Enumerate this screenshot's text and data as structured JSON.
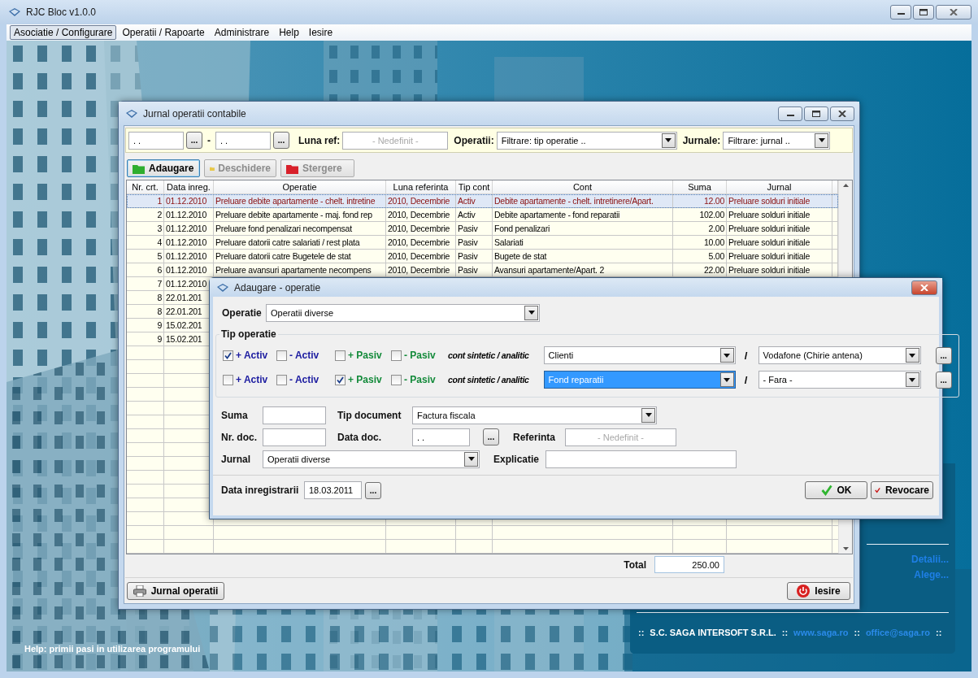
{
  "window": {
    "title": "RJC Bloc v1.0.0"
  },
  "menu": [
    {
      "label": "Asociatie / Configurare",
      "selected": true
    },
    {
      "label": "Operatii / Rapoarte",
      "selected": false
    },
    {
      "label": "Administrare",
      "selected": false
    },
    {
      "label": "Help",
      "selected": false
    },
    {
      "label": "Iesire",
      "selected": false
    }
  ],
  "journal": {
    "title": "Jurnal operatii contabile",
    "filters": {
      "date_from": {
        "value": ". .",
        "button": "..."
      },
      "dash": "-",
      "date_to": {
        "value": ". .",
        "button": "..."
      },
      "luna_ref": {
        "label": "Luna ref:",
        "placeholder": "- Nedefinit -"
      },
      "operatii": {
        "label": "Operatii:",
        "value": "Filtrare: tip operatie .."
      },
      "jurnale": {
        "label": "Jurnale:",
        "value": "Filtrare: jurnal .."
      }
    },
    "actions": [
      {
        "label": "Adaugare",
        "color": "#2fae2f",
        "disabled": false,
        "focused": true
      },
      {
        "label": "Deschidere",
        "color": "#e8c84a",
        "disabled": true,
        "focused": false
      },
      {
        "label": "Stergere",
        "color": "#d8202a",
        "disabled": true,
        "focused": false
      }
    ],
    "table": {
      "columns": [
        "Nr. crt.",
        "Data inreg.",
        "Operatie",
        "Luna referinta",
        "Tip cont",
        "Cont",
        "Suma",
        "Jurnal"
      ],
      "rows": [
        {
          "selected": true,
          "cells": [
            "1",
            "01.12.2010",
            "Preluare debite apartamente - chelt. intretine",
            "2010, Decembrie",
            "Activ",
            "Debite apartamente - chelt. intretinere/Apart.",
            "12.00",
            "Preluare solduri initiale"
          ]
        },
        {
          "selected": false,
          "cells": [
            "2",
            "01.12.2010",
            "Preluare debite apartamente - maj. fond rep",
            "2010, Decembrie",
            "Activ",
            "Debite apartamente - fond reparatii",
            "102.00",
            "Preluare solduri initiale"
          ]
        },
        {
          "selected": false,
          "cells": [
            "3",
            "01.12.2010",
            "Preluare fond penalizari necompensat",
            "2010, Decembrie",
            "Pasiv",
            "Fond penalizari",
            "2.00",
            "Preluare solduri initiale"
          ]
        },
        {
          "selected": false,
          "cells": [
            "4",
            "01.12.2010",
            "Preluare datorii catre salariati / rest plata",
            "2010, Decembrie",
            "Pasiv",
            "Salariati",
            "10.00",
            "Preluare solduri initiale"
          ]
        },
        {
          "selected": false,
          "cells": [
            "5",
            "01.12.2010",
            "Preluare datorii catre Bugetele de stat",
            "2010, Decembrie",
            "Pasiv",
            "Bugete de stat",
            "5.00",
            "Preluare solduri initiale"
          ]
        },
        {
          "selected": false,
          "cells": [
            "6",
            "01.12.2010",
            "Preluare avansuri apartamente necompens",
            "2010, Decembrie",
            "Pasiv",
            "Avansuri apartamente/Apart. 2",
            "22.00",
            "Preluare solduri initiale"
          ]
        },
        {
          "selected": false,
          "cells": [
            "7",
            "01.12.2010"
          ]
        },
        {
          "selected": false,
          "cells": [
            "8",
            "22.01.201"
          ]
        },
        {
          "selected": false,
          "cells": [
            "8",
            "22.01.201"
          ]
        },
        {
          "selected": false,
          "cells": [
            "9",
            "15.02.201"
          ]
        },
        {
          "selected": false,
          "cells": [
            "9",
            "15.02.201"
          ]
        }
      ]
    },
    "total": {
      "label": "Total",
      "value": "250.00"
    },
    "buttons": [
      {
        "label": "Jurnal operatii",
        "kind": "print"
      },
      {
        "label": "Iesire",
        "kind": "exit"
      }
    ]
  },
  "dialog": {
    "title": "Adaugare - operatie",
    "operatie": {
      "label": "Operatie",
      "value": "Operatii diverse"
    },
    "group_title": "Tip operatie",
    "lines": [
      {
        "checks": [
          {
            "label": "+ Activ",
            "kind": "activ",
            "checked": true
          },
          {
            "label": "- Activ",
            "kind": "activ",
            "checked": false
          },
          {
            "label": "+ Pasiv",
            "kind": "pasiv",
            "checked": false
          },
          {
            "label": "- Pasiv",
            "kind": "pasiv",
            "checked": false
          }
        ],
        "caption": "cont sintetic / analitic",
        "sintetic": "Clienti",
        "sintetic_focused": false,
        "slash": "/",
        "analitic": "Vodafone (Chirie antena)",
        "button": "..."
      },
      {
        "checks": [
          {
            "label": "+ Activ",
            "kind": "activ",
            "checked": false
          },
          {
            "label": "- Activ",
            "kind": "activ",
            "checked": false
          },
          {
            "label": "+ Pasiv",
            "kind": "pasiv",
            "checked": true
          },
          {
            "label": "- Pasiv",
            "kind": "pasiv",
            "checked": false
          }
        ],
        "caption": "cont sintetic / analitic",
        "sintetic": "Fond reparatii",
        "sintetic_focused": true,
        "slash": "/",
        "analitic": "- Fara -",
        "button": "..."
      }
    ],
    "fields": {
      "suma": {
        "label": "Suma"
      },
      "tip_document": {
        "label": "Tip document",
        "value": "Factura fiscala"
      },
      "nr_doc": {
        "label": "Nr. doc."
      },
      "data_doc": {
        "label": "Data doc.",
        "value": ". .",
        "button": "..."
      },
      "referinta": {
        "label": "Referinta",
        "placeholder": "- Nedefinit -"
      },
      "jurnal": {
        "label": "Jurnal",
        "value": "Operatii diverse"
      },
      "explicatie": {
        "label": "Explicatie"
      }
    },
    "data_inregistrarii": {
      "label": "Data inregistrarii",
      "value": "18.03.2011",
      "button": "..."
    },
    "buttons": [
      {
        "label": "OK",
        "kind": "ok"
      },
      {
        "label": "Revocare",
        "kind": "cancel"
      }
    ]
  },
  "side_panel": {
    "links": [
      "Detalii...",
      "Alege..."
    ],
    "footer": [
      {
        "text": "::",
        "kind": "sep"
      },
      {
        "text": "S.C. SAGA INTERSOFT S.R.L.",
        "kind": "text"
      },
      {
        "text": "::",
        "kind": "sep"
      },
      {
        "text": "www.saga.ro",
        "kind": "link"
      },
      {
        "text": "::",
        "kind": "sep"
      },
      {
        "text": "office@saga.ro",
        "kind": "link"
      },
      {
        "text": "::",
        "kind": "sep"
      }
    ]
  },
  "help": "Help: primii pasi in utilizarea programului"
}
